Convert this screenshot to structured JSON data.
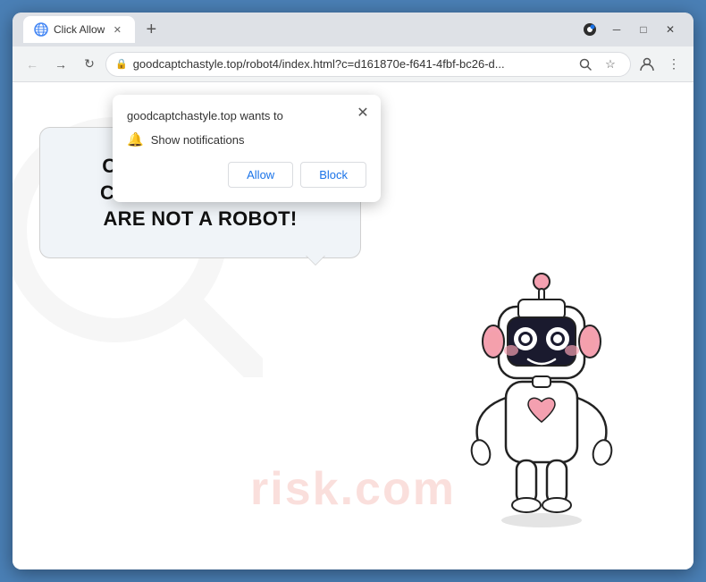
{
  "window": {
    "title": "Click Allow",
    "tab_title": "Click Allow"
  },
  "titlebar": {
    "minimize": "─",
    "maximize": "□",
    "close": "✕",
    "new_tab": "+"
  },
  "toolbar": {
    "back": "←",
    "forward": "→",
    "reload": "↻",
    "address": "goodcaptchastyle.top/robot4/index.html?c=d161870e-f641-4fbf-bc26-d...",
    "address_display": "goodcaptchastyle.top/robot4/index.html?c=d161870e-f641-4fbf-bc26-d..."
  },
  "popup": {
    "site_text": "goodcaptchastyle.top wants to",
    "notification_label": "Show notifications",
    "allow_label": "Allow",
    "block_label": "Block",
    "close": "✕"
  },
  "page": {
    "captcha_line1": "CLICK «ALLOW» TO CONFIRM THAT YOU",
    "captcha_line2": "ARE NOT A ROBOT!",
    "watermark": "risk.com"
  }
}
